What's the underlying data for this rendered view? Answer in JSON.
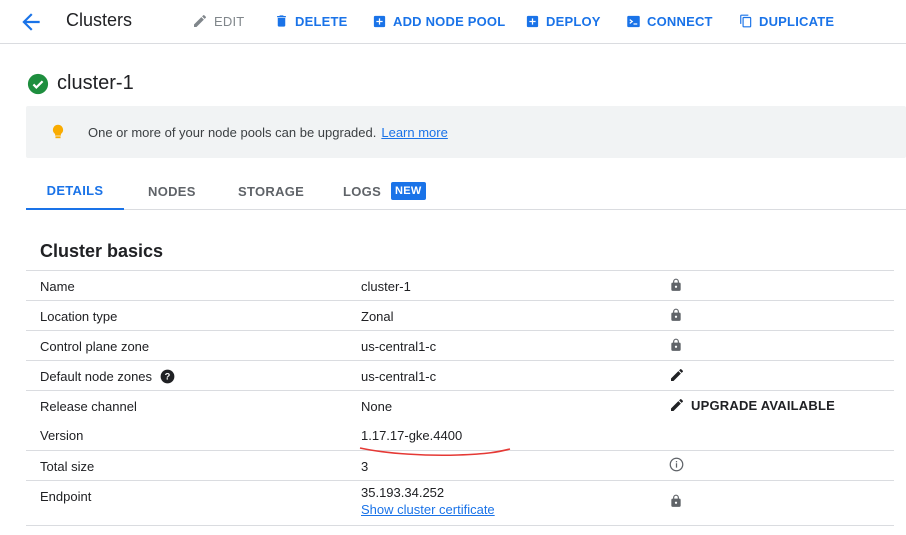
{
  "toolbar": {
    "title": "Clusters",
    "edit_label": "EDIT",
    "delete_label": "DELETE",
    "add_node_pool_label": "ADD NODE POOL",
    "deploy_label": "DEPLOY",
    "connect_label": "CONNECT",
    "duplicate_label": "DUPLICATE"
  },
  "cluster": {
    "name": "cluster-1",
    "status": "running"
  },
  "banner": {
    "message": "One or more of your node pools can be upgraded.",
    "link": "Learn more"
  },
  "tabs": [
    {
      "label": "DETAILS",
      "active": true
    },
    {
      "label": "NODES"
    },
    {
      "label": "STORAGE"
    },
    {
      "label": "LOGS",
      "badge": "NEW"
    }
  ],
  "section": {
    "title": "Cluster basics",
    "rows": [
      {
        "label": "Name",
        "value": "cluster-1",
        "icon": "lock-icon"
      },
      {
        "label": "Location type",
        "value": "Zonal",
        "icon": "lock-icon"
      },
      {
        "label": "Control plane zone",
        "value": "us-central1-c",
        "icon": "lock-icon"
      },
      {
        "label": "Default node zones",
        "value": "us-central1-c",
        "icon": "edit-icon",
        "help": true
      },
      {
        "label": "Release channel",
        "value": "None",
        "icon": "edit-icon",
        "action": "UPGRADE AVAILABLE"
      },
      {
        "label": "Version",
        "value": "1.17.17-gke.4400"
      },
      {
        "label": "Total size",
        "value": "3",
        "icon": "info-icon"
      },
      {
        "label": "Endpoint",
        "value": "35.193.34.252",
        "link": "Show cluster certificate",
        "icon": "lock-icon"
      }
    ]
  },
  "colors": {
    "accent": "#1a73e8",
    "success": "#1e8e3e",
    "warning": "#f9ab00",
    "annotation": "#e53935"
  }
}
